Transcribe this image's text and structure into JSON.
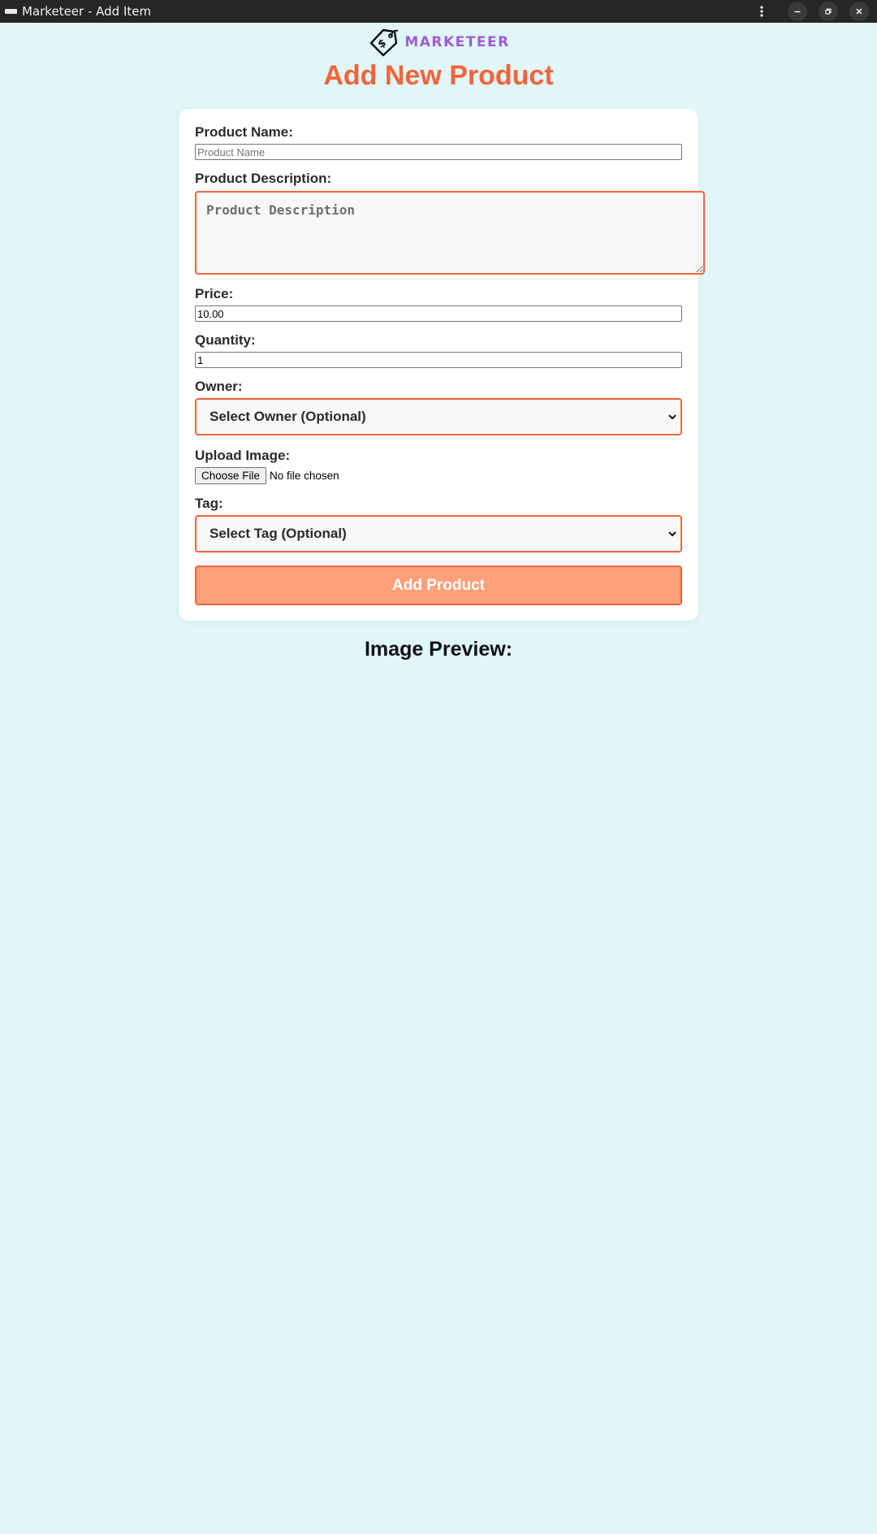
{
  "window": {
    "title": "Marketeer - Add Item"
  },
  "brand": {
    "name": "MARKETEER",
    "accent": "#a15ad6"
  },
  "page": {
    "heading": "Add New Product",
    "heading_color": "#f2643b"
  },
  "form": {
    "product_name": {
      "label": "Product Name:",
      "placeholder": "Product Name",
      "value": ""
    },
    "description": {
      "label": "Product Description:",
      "placeholder": "Product Description",
      "value": ""
    },
    "price": {
      "label": "Price:",
      "value": "10.00"
    },
    "quantity": {
      "label": "Quantity:",
      "value": "1"
    },
    "owner": {
      "label": "Owner:",
      "selected": "Select Owner (Optional)"
    },
    "image": {
      "label": "Upload Image:",
      "button": "Choose File",
      "status": "No file chosen"
    },
    "tag": {
      "label": "Tag:",
      "selected": "Select Tag (Optional)"
    },
    "submit_label": "Add Product"
  },
  "preview": {
    "heading": "Image Preview:"
  },
  "colors": {
    "background": "#e0f6f8",
    "submit_bg": "#ffa07a",
    "border_accent": "#f2643b"
  }
}
